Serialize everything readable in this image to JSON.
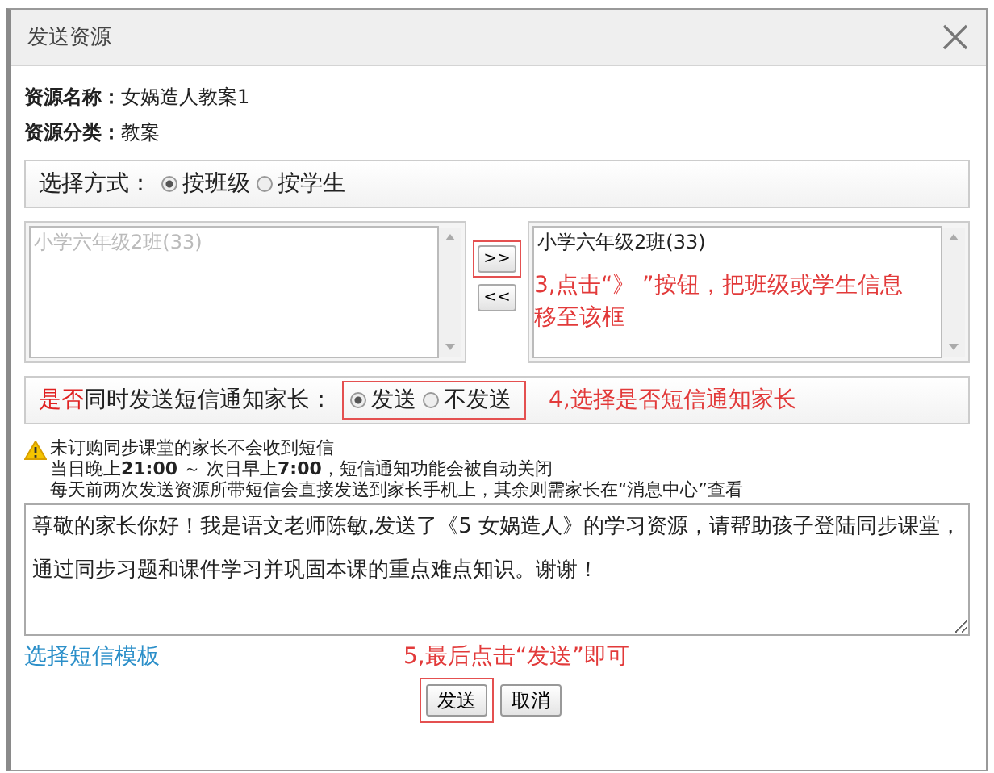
{
  "window": {
    "title": "发送资源"
  },
  "info": [
    {
      "label": "资源名称：",
      "value": "女娲造人教案1"
    },
    {
      "label": "资源分类：",
      "value": "教案"
    }
  ],
  "select_mode": {
    "label": "选择方式：",
    "options": [
      {
        "label": "按班级",
        "selected": true
      },
      {
        "label": "按学生",
        "selected": false
      }
    ]
  },
  "source_list": {
    "items": [
      {
        "label": "小学六年级2班(33)",
        "disabled": true
      }
    ]
  },
  "move_buttons": [
    ">>",
    "<<"
  ],
  "target_list": {
    "items": [
      {
        "label": "小学六年级2班(33)",
        "disabled": false
      }
    ]
  },
  "sms_option": {
    "label_highlight": "是否",
    "label": "同时发送短信通知家长：",
    "options": [
      {
        "label": "发送",
        "selected": true
      },
      {
        "label": "不发送",
        "selected": false
      }
    ]
  },
  "notices": [
    "未订购同步课堂的家长不会收到短信",
    "当日晚上**21:00** ～ 次日早上**7:00**，短信通知功能会被自动关闭",
    "每天前两次发送资源所带短信会直接发送到家长手机上，其余则需家长在“消息中心”查看"
  ],
  "message": "尊敬的家长你好！我是语文老师陈敏,发送了《5 女娲造人》的学习资源，请帮助孩子登陆同步课堂，通过同步习题和课件学习并巩固本课的重点难点知识。谢谢！",
  "template_link": "选择短信模板",
  "annotations": [
    "3,点击“》 ”按钮，把班级或学生信息移至该框",
    "4,选择是否短信通知家长",
    "5,最后点击“发送”即可"
  ],
  "buttons": [
    "发送",
    "取消"
  ]
}
